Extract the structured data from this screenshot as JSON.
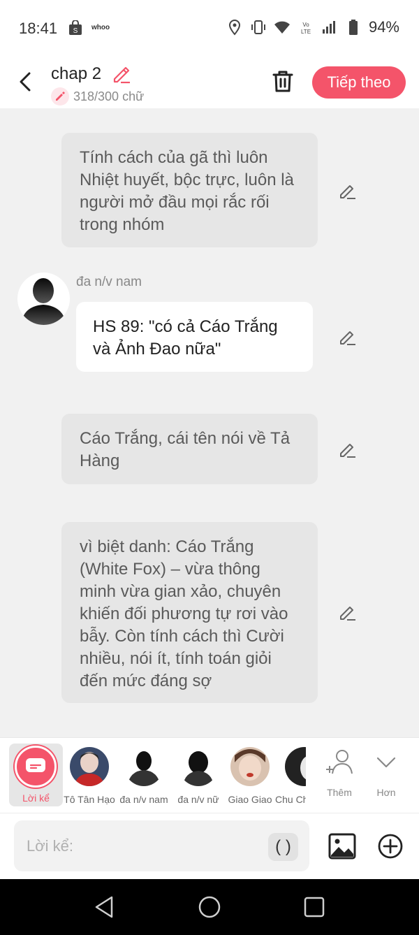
{
  "status_bar": {
    "time": "18:41",
    "app_label": "whoo",
    "battery": "94%"
  },
  "header": {
    "title": "chap 2",
    "word_count": "318/300 chữ",
    "next_label": "Tiếp theo"
  },
  "messages": [
    {
      "type": "narration",
      "text": "Tính cách của gã thì luôn Nhiệt huyết, bộc trực, luôn là người mở đầu mọi rắc rối trong nhóm"
    },
    {
      "type": "dialogue",
      "speaker": "đa n/v nam",
      "text": "HS 89: \"có cả Cáo Trắng và Ảnh Đao nữa\""
    },
    {
      "type": "narration",
      "text": "Cáo Trắng, cái tên nói về Tả Hàng"
    },
    {
      "type": "narration",
      "text": "vì biệt danh: Cáo Trắng (White Fox) – vừa thông minh vừa gian xảo, chuyên khiến đối phương tự rơi vào bẫy. Còn tính cách thì Cười nhiều, nói ít, tính toán giỏi đến mức đáng sợ"
    }
  ],
  "characters": {
    "selected": "Lời kể",
    "list": [
      "Tô Tân Hạo",
      "đa n/v nam",
      "đa n/v nữ",
      "Giao Giao",
      "Chu Chí Hâm"
    ],
    "add_label": "Thêm",
    "more_label": "Hơn"
  },
  "input": {
    "placeholder": "Lời kể:",
    "paren_label": "( )"
  },
  "colors": {
    "accent": "#f4546a",
    "content_bg": "#f1f1f1",
    "narration_bubble": "#e6e6e6"
  }
}
